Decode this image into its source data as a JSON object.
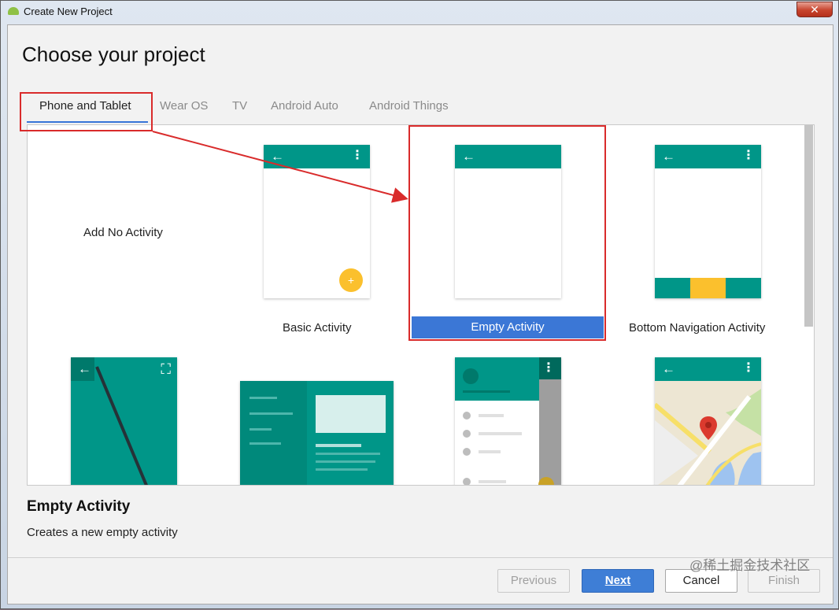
{
  "window": {
    "title": "Create New Project",
    "close_glyph": "✕"
  },
  "heading": "Choose your project",
  "tabs": [
    {
      "label": "Phone and Tablet",
      "active": true
    },
    {
      "label": "Wear OS",
      "active": false
    },
    {
      "label": "TV",
      "active": false
    },
    {
      "label": "Android Auto",
      "active": false
    },
    {
      "label": "Android Things",
      "active": false
    }
  ],
  "templates": {
    "no_activity": "Add No Activity",
    "basic": "Basic Activity",
    "empty": "Empty Activity",
    "bottom_nav": "Bottom Navigation Activity"
  },
  "icons": {
    "back": "←",
    "overflow": "⋮",
    "fab": "+",
    "fullscreen": "⛶"
  },
  "description": {
    "title": "Empty Activity",
    "text": "Creates a new empty activity"
  },
  "buttons": {
    "previous": "Previous",
    "next": "Next",
    "cancel": "Cancel",
    "finish": "Finish"
  },
  "watermark": "@稀土掘金技术社区",
  "colors": {
    "accent_teal": "#009688",
    "selection_blue": "#3b77d6",
    "highlight_red": "#d92b2b",
    "fab_yellow": "#fbc02d"
  }
}
